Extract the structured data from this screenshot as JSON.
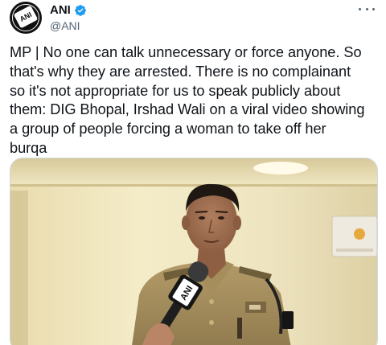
{
  "author": {
    "display_name": "ANI",
    "handle": "@ANI",
    "avatar_logo_text": "ANI",
    "verified": true
  },
  "tweet": {
    "text": "MP | No one can talk unnecessary or force anyone. So\nthat's why they are arrested. There is no complainant\nso it's not appropriate for us to speak publicly about\nthem: DIG Bhopal, Irshad Wali on a viral video showing\na group of people forcing a woman to take off her\nburqa"
  },
  "media": {
    "type": "video-still",
    "mic_label": "ANI"
  },
  "icons": {
    "verified": "verified-badge-icon",
    "more": "more-options-icon"
  },
  "colors": {
    "verified": "#1d9bf0",
    "text": "#0f1419",
    "secondary": "#536471"
  }
}
